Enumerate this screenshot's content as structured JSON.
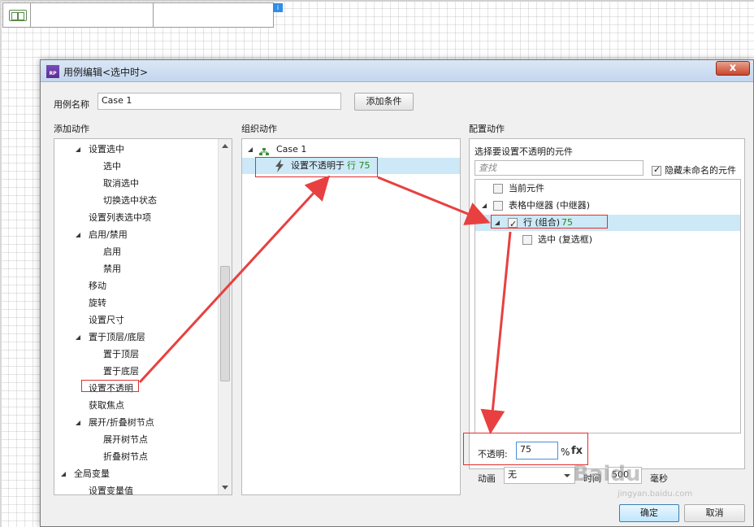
{
  "background": {
    "marker_label": "i"
  },
  "dialog": {
    "title": "用例编辑<选中时>",
    "close_label": "x",
    "case_name_label": "用例名称",
    "case_name_value": "Case 1",
    "add_condition_label": "添加条件",
    "add_action_header": "添加动作",
    "organize_action_header": "组织动作",
    "configure_action_header": "配置动作",
    "actions_tree": [
      {
        "label": "设置选中",
        "level": 1,
        "expanded": true
      },
      {
        "label": "选中",
        "level": 2
      },
      {
        "label": "取消选中",
        "level": 2
      },
      {
        "label": "切换选中状态",
        "level": 2
      },
      {
        "label": "设置列表选中项",
        "level": 1
      },
      {
        "label": "启用/禁用",
        "level": 1,
        "expanded": true
      },
      {
        "label": "启用",
        "level": 2
      },
      {
        "label": "禁用",
        "level": 2
      },
      {
        "label": "移动",
        "level": 1
      },
      {
        "label": "旋转",
        "level": 1
      },
      {
        "label": "设置尺寸",
        "level": 1
      },
      {
        "label": "置于顶层/底层",
        "level": 1,
        "expanded": true
      },
      {
        "label": "置于顶层",
        "level": 2
      },
      {
        "label": "置于底层",
        "level": 2
      },
      {
        "label": "设置不透明",
        "level": 1,
        "highlighted": true
      },
      {
        "label": "获取焦点",
        "level": 1
      },
      {
        "label": "展开/折叠树节点",
        "level": 1,
        "expanded": true
      },
      {
        "label": "展开树节点",
        "level": 2
      },
      {
        "label": "折叠树节点",
        "level": 2
      },
      {
        "label": "全局变量",
        "level": 0,
        "expanded": true
      },
      {
        "label": "设置变量值",
        "level": 1
      }
    ],
    "organize": {
      "case_label": "Case 1",
      "action_text": "设置不透明于",
      "action_target": "行 75"
    },
    "configure": {
      "prompt": "选择要设置不透明的元件",
      "search_placeholder": "查找",
      "hide_unnamed_label": "隐藏未命名的元件",
      "items": [
        {
          "label": "当前元件",
          "suffix": ""
        },
        {
          "label": "表格中继器 (中继器)",
          "suffix": ""
        },
        {
          "label": "行 (组合)",
          "suffix": "75"
        },
        {
          "label": "选中 (复选框)",
          "suffix": ""
        }
      ],
      "opacity_label": "不透明:",
      "opacity_value": "75",
      "percent_label": "%",
      "fx_label": "fx",
      "animation_label": "动画",
      "animation_value": "无",
      "time_label": "时间",
      "time_value": "500",
      "ms_label": "毫秒"
    },
    "ok_label": "确定",
    "cancel_label": "取消"
  },
  "watermark": {
    "logo": "Baidu",
    "sub": "jingyan.baidu.com"
  },
  "colors": {
    "annotation_red": "#e03030",
    "highlight_green": "#1c8a1c",
    "selection_blue": "#cde8f6"
  }
}
